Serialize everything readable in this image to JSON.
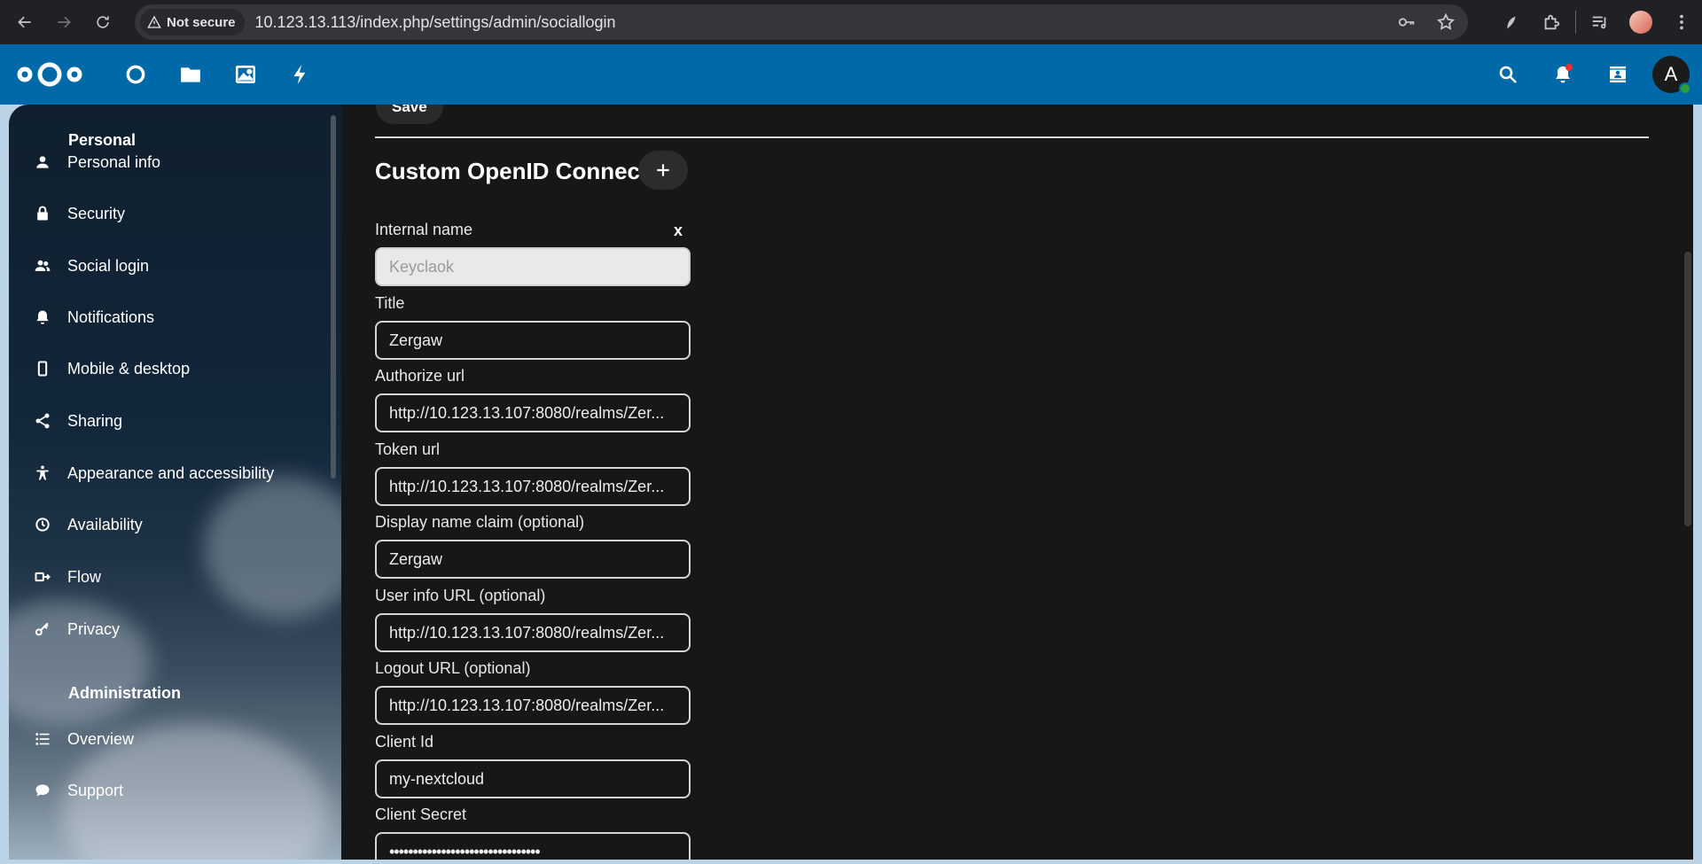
{
  "browser": {
    "security_label": "Not secure",
    "url": "10.123.13.113/index.php/settings/admin/sociallogin"
  },
  "header": {
    "avatar_initial": "A",
    "colors": {
      "brand": "#0069a8",
      "status_online": "#2d9e3a",
      "notification": "#e9322d"
    }
  },
  "sidebar": {
    "personal_title": "Personal",
    "personal_items": [
      {
        "label": "Personal info",
        "icon": "user-icon"
      },
      {
        "label": "Security",
        "icon": "lock-icon"
      },
      {
        "label": "Social login",
        "icon": "users-icon"
      },
      {
        "label": "Notifications",
        "icon": "bell-icon"
      },
      {
        "label": "Mobile & desktop",
        "icon": "phone-icon"
      },
      {
        "label": "Sharing",
        "icon": "share-icon"
      },
      {
        "label": "Appearance and accessibility",
        "icon": "accessibility-icon"
      },
      {
        "label": "Availability",
        "icon": "clock-icon"
      },
      {
        "label": "Flow",
        "icon": "flow-icon"
      },
      {
        "label": "Privacy",
        "icon": "key-icon"
      }
    ],
    "admin_title": "Administration",
    "admin_items": [
      {
        "label": "Overview",
        "icon": "list-icon"
      },
      {
        "label": "Support",
        "icon": "chat-icon"
      }
    ]
  },
  "content": {
    "save_label": "Save",
    "section_heading": "Custom OpenID Connect",
    "remove_label": "x",
    "fields": {
      "internal_name": {
        "label": "Internal name",
        "placeholder": "Keyclaok"
      },
      "title": {
        "label": "Title",
        "value": "Zergaw"
      },
      "authorize_url": {
        "label": "Authorize url",
        "value": "http://10.123.13.107:8080/realms/Zer..."
      },
      "token_url": {
        "label": "Token url",
        "value": "http://10.123.13.107:8080/realms/Zer..."
      },
      "display_name_claim": {
        "label": "Display name claim (optional)",
        "value": "Zergaw"
      },
      "user_info_url": {
        "label": "User info URL (optional)",
        "value": "http://10.123.13.107:8080/realms/Zer..."
      },
      "logout_url": {
        "label": "Logout URL (optional)",
        "value": "http://10.123.13.107:8080/realms/Zer..."
      },
      "client_id": {
        "label": "Client Id",
        "value": "my-nextcloud"
      },
      "client_secret": {
        "label": "Client Secret",
        "value": "••••••••••••••••••••••••••••••••"
      }
    }
  }
}
